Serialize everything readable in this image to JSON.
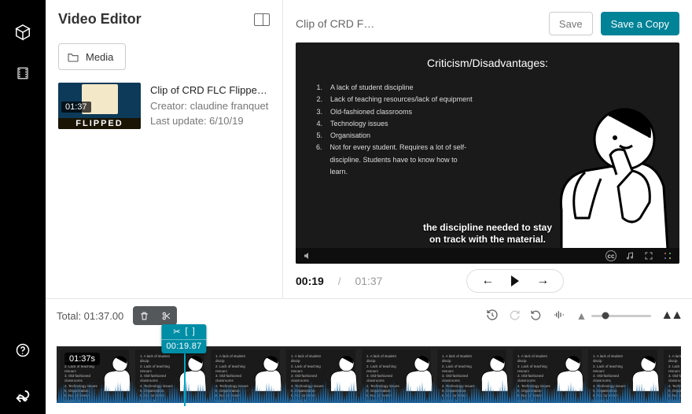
{
  "rail": {
    "back": "↩"
  },
  "left": {
    "title": "Video Editor",
    "media_label": "Media",
    "clip": {
      "title": "Clip of CRD FLC Flippe…",
      "creator_line": "Creator: claudine franquet",
      "updated_line": "Last update: 6/10/19",
      "thumb_time": "01:37",
      "thumb_label": "FLIPPED"
    }
  },
  "preview": {
    "title": "Clip of CRD F…",
    "save": "Save",
    "save_copy": "Save a Copy",
    "slide_title": "Criticism/Disadvantages:",
    "bullets": [
      "A lack of student discipline",
      "Lack of teaching resources/lack of equipment",
      "Old-fashioned classrooms",
      "Technology issues",
      "Organisation",
      "Not for every student. Requires a lot of self-discipline. Students have to know how to learn."
    ],
    "caption_line1": "the discipline needed to stay",
    "caption_line2": "on track with the material.",
    "time_now": "00:19",
    "time_dur": "01:37",
    "cc": "cc"
  },
  "timeline": {
    "total_label": "Total: 01:37.00",
    "badge": "01:37s",
    "playhead_time": "00:19.87",
    "playhead_pct": 20.4
  }
}
